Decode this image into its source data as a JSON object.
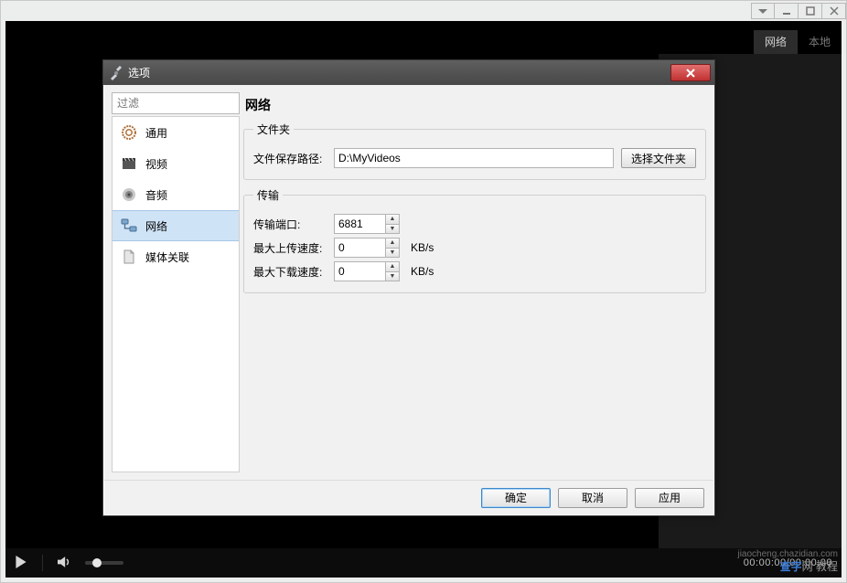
{
  "outer_window": {
    "tabs": {
      "network": "网络",
      "local": "本地"
    }
  },
  "player": {
    "time": "00:00:00/00:00:00"
  },
  "watermark": {
    "blue": "查字",
    "gray": "网 教程",
    "url": "jiaocheng.chazidian.com"
  },
  "dialog": {
    "title": "选项",
    "filter_placeholder": "过滤",
    "sidebar": {
      "items": [
        {
          "label": "通用"
        },
        {
          "label": "视频"
        },
        {
          "label": "音频"
        },
        {
          "label": "网络"
        },
        {
          "label": "媒体关联"
        }
      ]
    },
    "content": {
      "title": "网络",
      "folder_group": {
        "legend": "文件夹",
        "path_label": "文件保存路径:",
        "path_value": "D:\\MyVideos",
        "browse_btn": "选择文件夹"
      },
      "transfer_group": {
        "legend": "传输",
        "port_label": "传输端口:",
        "port_value": "6881",
        "up_label": "最大上传速度:",
        "up_value": "0",
        "down_label": "最大下载速度:",
        "down_value": "0",
        "unit": "KB/s"
      }
    },
    "footer": {
      "ok": "确定",
      "cancel": "取消",
      "apply": "应用"
    }
  }
}
